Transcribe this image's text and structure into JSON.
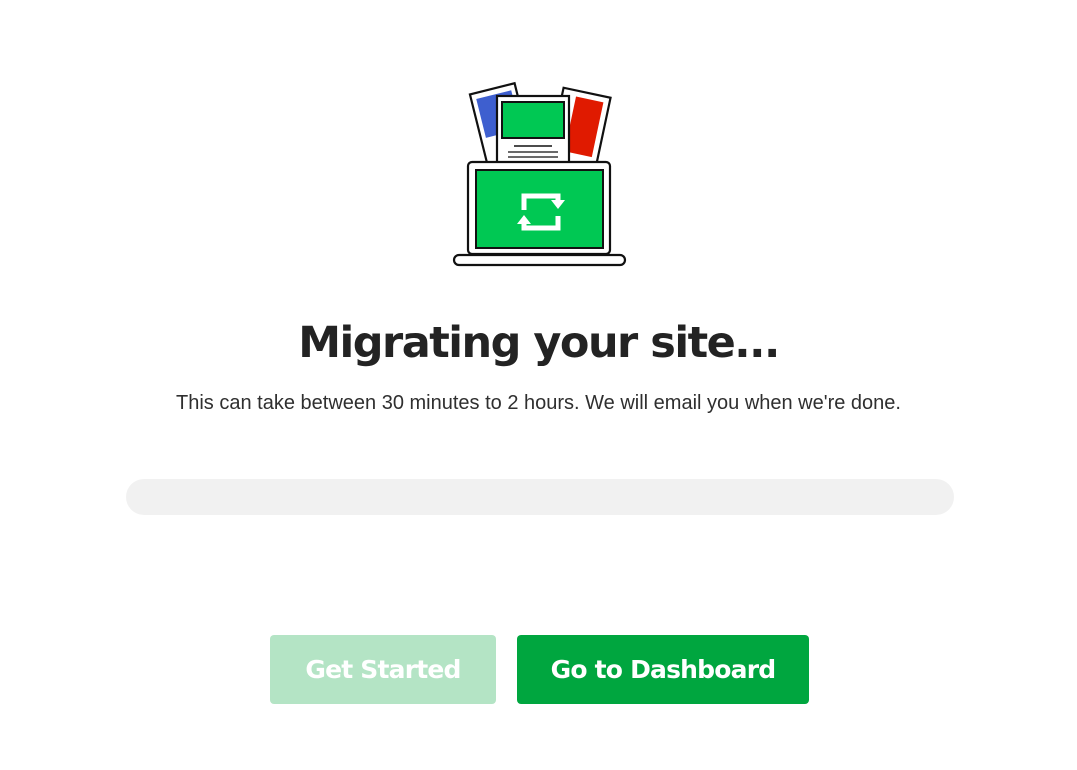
{
  "illustration": {
    "name": "site-migration-illustration",
    "colors": {
      "screen_green": "#00c853",
      "blue_doc": "#3e5fcf",
      "red_doc": "#e01a00",
      "outline": "#111111"
    }
  },
  "main": {
    "title": "Migrating your site...",
    "subtitle": "This can take between 30 minutes to 2 hours. We will email you when we're done."
  },
  "progress": {
    "value_percent": 0,
    "track_color": "#f1f1f1",
    "fill_color": "#00a63f"
  },
  "actions": {
    "get_started_label": "Get Started",
    "get_started_state": "disabled",
    "dashboard_label": "Go to Dashboard",
    "accent_color": "#00a63f",
    "disabled_color": "#b4e4c5"
  }
}
